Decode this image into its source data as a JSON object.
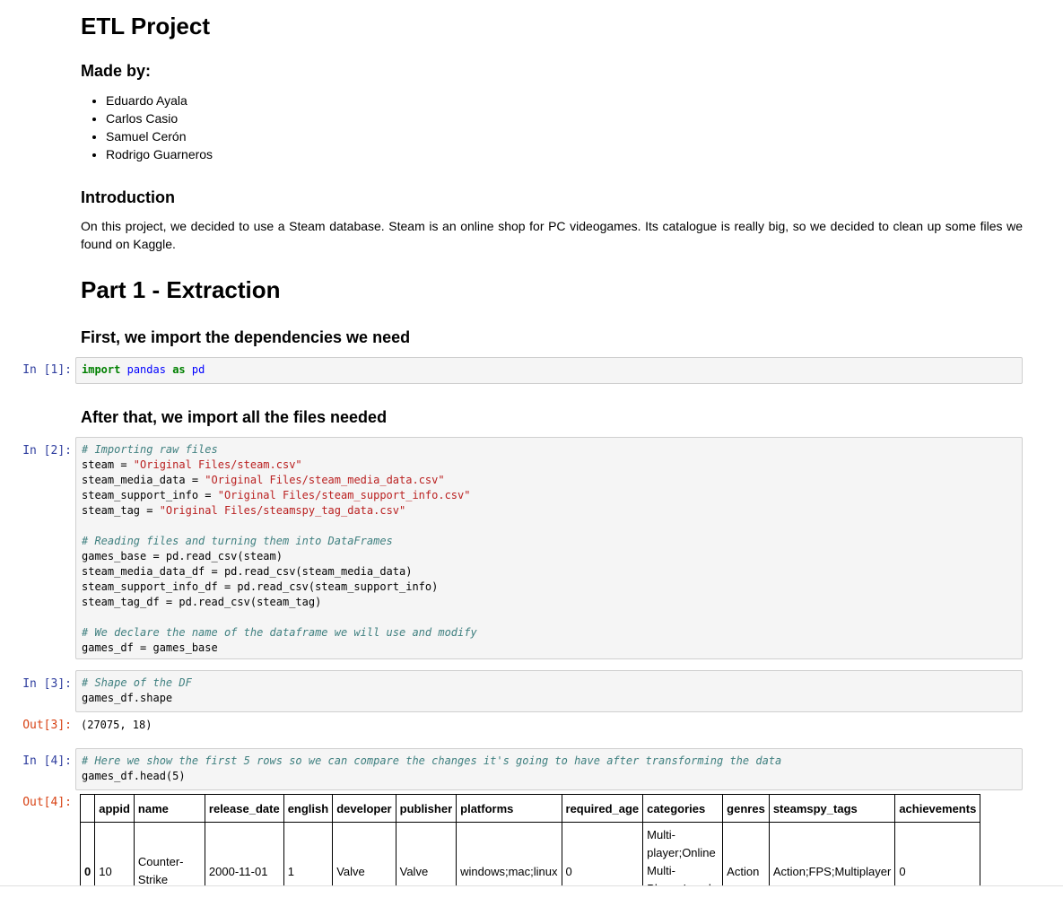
{
  "title": "ETL Project",
  "made_by_heading": "Made by:",
  "authors": [
    "Eduardo Ayala",
    "Carlos Casio",
    "Samuel Cerón",
    "Rodrigo Guarneros"
  ],
  "intro_heading": "Introduction",
  "intro_text": "On this project, we decided to use a Steam database. Steam is an online shop for PC videogames. Its catalogue is really big, so we decided to clean up some files we found on Kaggle.",
  "part1_heading": "Part 1 - Extraction",
  "deps_heading": "First, we import the dependencies we need",
  "files_heading": "After that, we import all the files needed",
  "cells": {
    "c1": {
      "prompt": "In [1]:",
      "kw_import": "import",
      "mod": "pandas",
      "kw_as": "as",
      "alias": "pd"
    },
    "c2": {
      "prompt": "In [2]:",
      "l1": "# Importing raw files",
      "l2a": "steam = ",
      "l2b": "\"Original Files/steam.csv\"",
      "l3a": "steam_media_data = ",
      "l3b": "\"Original Files/steam_media_data.csv\"",
      "l4a": "steam_support_info = ",
      "l4b": "\"Original Files/steam_support_info.csv\"",
      "l5a": "steam_tag = ",
      "l5b": "\"Original Files/steamspy_tag_data.csv\"",
      "l7": "# Reading files and turning them into DataFrames",
      "l8": "games_base = pd.read_csv(steam)",
      "l9": "steam_media_data_df = pd.read_csv(steam_media_data)",
      "l10": "steam_support_info_df = pd.read_csv(steam_support_info)",
      "l11": "steam_tag_df = pd.read_csv(steam_tag)",
      "l13": "# We declare the name of the dataframe we will use and modify",
      "l14": "games_df = games_base"
    },
    "c3": {
      "prompt": "In [3]:",
      "l1": "# Shape of the DF",
      "l2": "games_df.shape",
      "out_prompt": "Out[3]:",
      "out": "(27075, 18)"
    },
    "c4": {
      "prompt": "In [4]:",
      "l1": "# Here we show the first 5 rows so we can compare the changes it's going to have after transforming the data",
      "l2": "games_df.head(5)",
      "out_prompt": "Out[4]:"
    }
  },
  "table": {
    "columns": [
      "",
      "appid",
      "name",
      "release_date",
      "english",
      "developer",
      "publisher",
      "platforms",
      "required_age",
      "categories",
      "genres",
      "steamspy_tags",
      "achievements"
    ],
    "row0": [
      "0",
      "10",
      "Counter-Strike",
      "2000-11-01",
      "1",
      "Valve",
      "Valve",
      "windows;mac;linux",
      "0",
      "Multi-player;Online Multi-Player;Local Multi-Player",
      "Action",
      "Action;FPS;Multiplayer",
      "0"
    ]
  }
}
